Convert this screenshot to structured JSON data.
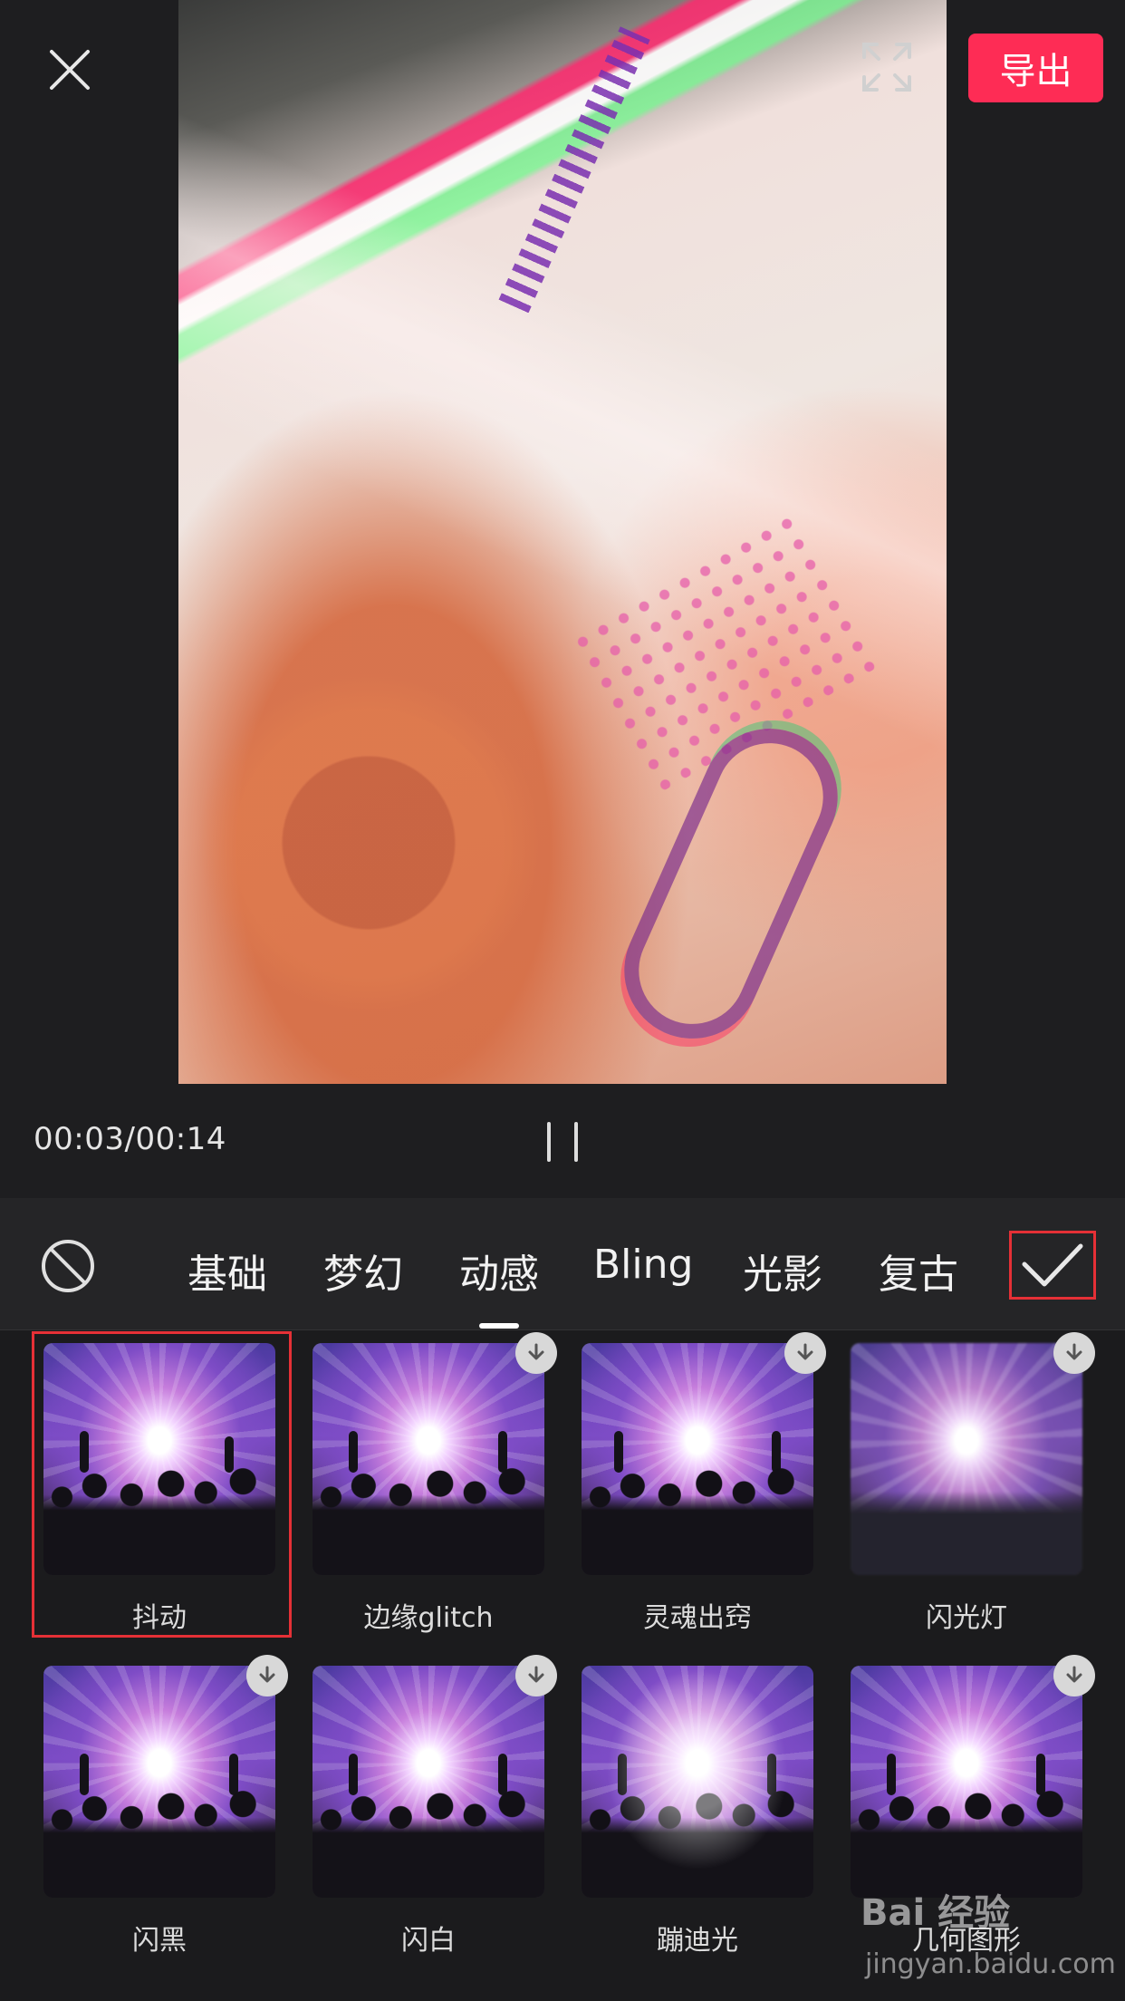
{
  "header": {
    "export_label": "导出"
  },
  "player": {
    "time": "00:03/00:14"
  },
  "tabs": [
    {
      "label": "基础"
    },
    {
      "label": "梦幻"
    },
    {
      "label": "动感",
      "active": true
    },
    {
      "label": "Bling"
    },
    {
      "label": "光影"
    },
    {
      "label": "复古"
    }
  ],
  "effects": [
    {
      "label": "抖动",
      "selected": true,
      "downloaded": true
    },
    {
      "label": "边缘glitch",
      "downloaded": false
    },
    {
      "label": "灵魂出窍",
      "downloaded": false
    },
    {
      "label": "闪光灯",
      "downloaded": false
    },
    {
      "label": "闪黑",
      "downloaded": false
    },
    {
      "label": "闪白",
      "downloaded": false
    },
    {
      "label": "蹦迪光",
      "downloaded": true
    },
    {
      "label": "几何图形",
      "downloaded": false
    }
  ],
  "icons": {
    "close": "close-icon",
    "fullscreen": "fullscreen-icon",
    "pause": "pause-icon",
    "none": "no-effect-icon",
    "confirm": "checkmark-icon",
    "download": "download-arrow-icon"
  },
  "colors": {
    "accent": "#fe2c55",
    "highlight_border": "#e53036",
    "background": "#1e1e20"
  },
  "watermark": {
    "brand": "Bai 经验",
    "url": "jingyan.baidu.com"
  }
}
